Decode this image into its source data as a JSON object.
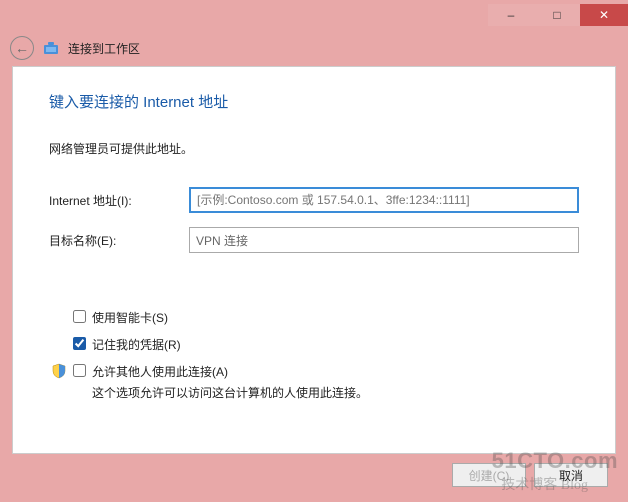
{
  "titlebar": {
    "minimize": "–",
    "maximize": "□",
    "close": "✕"
  },
  "toolbar": {
    "back": "←",
    "title": "连接到工作区"
  },
  "heading": "键入要连接的 Internet 地址",
  "subtitle": "网络管理员可提供此地址。",
  "fields": {
    "internet_label": "Internet 地址(I):",
    "internet_placeholder": "[示例:Contoso.com 或 157.54.0.1、3ffe:1234::1111]",
    "dest_label": "目标名称(E):",
    "dest_value": "VPN 连接"
  },
  "checks": {
    "smartcard": "使用智能卡(S)",
    "remember": "记住我的凭据(R)",
    "allow_others": "允许其他人使用此连接(A)",
    "allow_desc": "这个选项允许可以访问这台计算机的人使用此连接。"
  },
  "footer": {
    "create": "创建(C)",
    "cancel": "取消"
  },
  "watermark": {
    "line1": "51CTO.com",
    "line2": "技术博客 Blog"
  }
}
